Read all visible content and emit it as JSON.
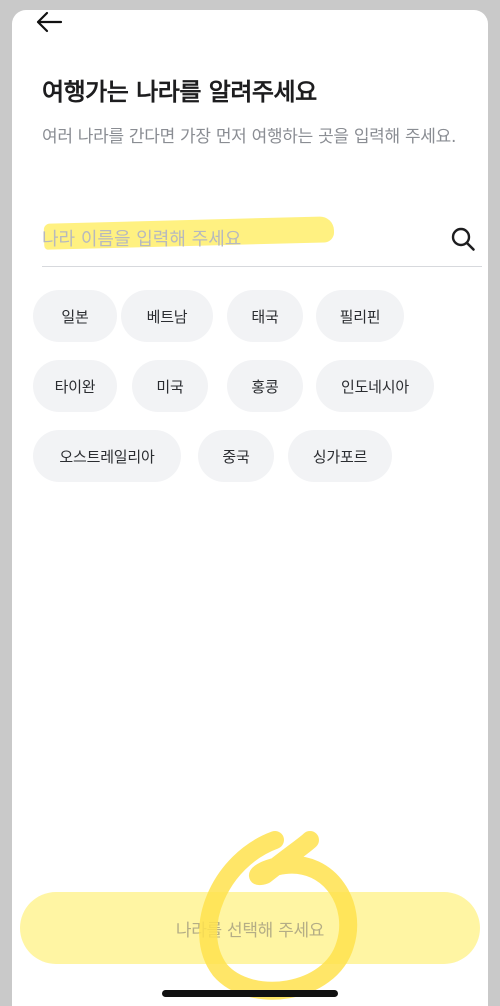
{
  "header": {
    "back_icon": "arrow-left-icon"
  },
  "page": {
    "title": "여행가는 나라를 알려주세요",
    "subtitle": "여러 나라를 간다면 가장 먼저 여행하는 곳을 입력해 주세요."
  },
  "search": {
    "placeholder": "나라 이름을 입력해 주세요",
    "value": "",
    "icon": "search-icon"
  },
  "countries": [
    "일본",
    "베트남",
    "태국",
    "필리핀",
    "타이완",
    "미국",
    "홍콩",
    "인도네시아",
    "오스트레일리아",
    "중국",
    "싱가포르"
  ],
  "cta": {
    "label": "나라를 선택해 주세요",
    "enabled": false
  },
  "colors": {
    "background": "#c9c9c9",
    "chip": "#f2f3f5",
    "highlight": "#fff07a",
    "cta": "#fff5a3"
  }
}
